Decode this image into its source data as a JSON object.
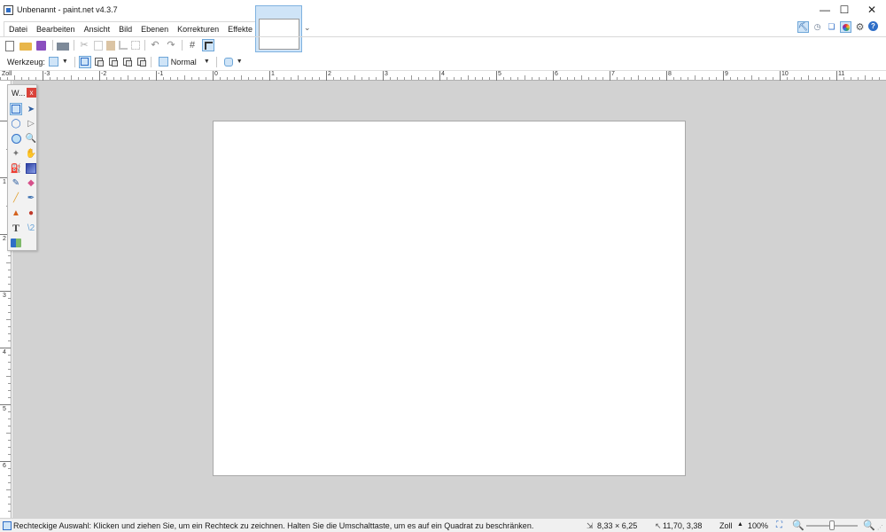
{
  "window": {
    "title": "Unbenannt - paint.net v4.3.7",
    "minimize_glyph": "—",
    "maximize_glyph": "☐",
    "close_glyph": "✕"
  },
  "menu": {
    "items": [
      {
        "label": "Datei"
      },
      {
        "label": "Bearbeiten"
      },
      {
        "label": "Ansicht"
      },
      {
        "label": "Bild"
      },
      {
        "label": "Ebenen"
      },
      {
        "label": "Korrekturen"
      },
      {
        "label": "Effekte"
      }
    ]
  },
  "image_tabs": {
    "dropdown_glyph": "⌄"
  },
  "right_icons": {
    "gear_glyph": "⚙",
    "help_glyph": "?"
  },
  "toolbar": {
    "tool_label": "Werkzeug:",
    "blend_mode": "Normal",
    "dropdown_glyph": "▼",
    "icons": [
      "new-icon",
      "open-icon",
      "save-icon",
      "print-icon",
      "cut-icon",
      "copy-icon",
      "paste-icon",
      "crop-icon",
      "deselect-icon",
      "undo-icon",
      "redo-icon",
      "grid-icon",
      "rulers-icon"
    ]
  },
  "ruler": {
    "units_label": "Zoll",
    "h_ticks": [
      "-4",
      "-3",
      "-2",
      "-1",
      "0",
      "1",
      "2",
      "3",
      "4",
      "5",
      "6",
      "7",
      "8",
      "9",
      "10",
      "11"
    ],
    "v_ticks": [
      "1",
      "2",
      "3",
      "4",
      "5",
      "6"
    ]
  },
  "tools_window": {
    "title": "W...",
    "close_glyph": "x",
    "tools": [
      {
        "name": "rectangle-select-tool",
        "glyph": "",
        "active": true
      },
      {
        "name": "move-selection-tool",
        "glyph": "➤"
      },
      {
        "name": "lasso-select-tool",
        "glyph": "◯"
      },
      {
        "name": "move-selected-tool",
        "glyph": "▷"
      },
      {
        "name": "ellipse-select-tool",
        "glyph": ""
      },
      {
        "name": "zoom-tool",
        "glyph": "🔍"
      },
      {
        "name": "magic-wand-tool",
        "glyph": "✦"
      },
      {
        "name": "pan-tool",
        "glyph": "✋"
      },
      {
        "name": "paint-bucket-tool",
        "glyph": "⛽"
      },
      {
        "name": "gradient-tool",
        "glyph": ""
      },
      {
        "name": "paintbrush-tool",
        "glyph": "✎"
      },
      {
        "name": "eraser-tool",
        "glyph": "◆"
      },
      {
        "name": "pencil-tool",
        "glyph": "╱"
      },
      {
        "name": "color-picker-tool",
        "glyph": "✒"
      },
      {
        "name": "clone-stamp-tool",
        "glyph": "▲"
      },
      {
        "name": "recolor-tool",
        "glyph": "●"
      },
      {
        "name": "text-tool",
        "glyph": "T"
      },
      {
        "name": "line-curve-tool",
        "glyph": "\\2"
      },
      {
        "name": "shapes-tool",
        "glyph": ""
      }
    ]
  },
  "status": {
    "hint": "Rechteckige Auswahl: Klicken und ziehen Sie, um ein Rechteck zu zeichnen. Halten Sie die Umschalttaste, um es auf ein Quadrat zu beschränken.",
    "image_size": "8,33 × 6,25",
    "cursor_position": "11,70, 3,38",
    "zoom_label": "Zoll",
    "zoom_value": "100%",
    "zoom_level": 0.5,
    "size_glyph": "⇲",
    "cursor_glyph": "↖",
    "zoom_arrow": "▲",
    "fit_glyph": "⛶",
    "zoom_out_glyph": "🔍",
    "zoom_in_glyph": "🔍",
    "grip_glyph": "⋰"
  },
  "colors": {
    "accent": "#2f6ec7",
    "workspace": "#d2d2d2",
    "canvas": "#ffffff"
  }
}
